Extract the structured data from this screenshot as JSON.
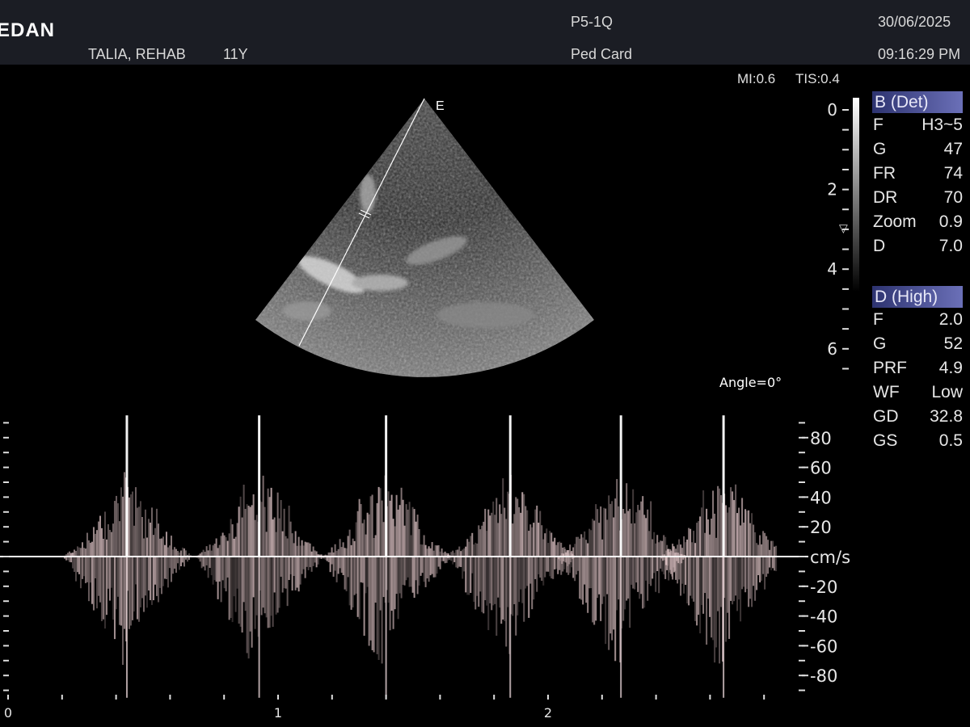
{
  "header": {
    "logo": "EDAN",
    "patient_name": "TALIA, REHAB",
    "patient_age": "11Y",
    "probe": "P5-1Q",
    "preset": "Ped Card",
    "date": "30/06/2025",
    "time": "09:16:29 PM"
  },
  "indices": {
    "mi": "MI:0.6",
    "tis": "TIS:0.4"
  },
  "bmode_panel": {
    "title": "B (Det)",
    "params": [
      {
        "key": "F",
        "value": "H3~5"
      },
      {
        "key": "G",
        "value": "47"
      },
      {
        "key": "FR",
        "value": "74"
      },
      {
        "key": "DR",
        "value": "70"
      },
      {
        "key": "Zoom",
        "value": "0.9"
      },
      {
        "key": "D",
        "value": "7.0"
      }
    ]
  },
  "doppler_panel": {
    "title": "D (High)",
    "params": [
      {
        "key": "F",
        "value": "2.0"
      },
      {
        "key": "G",
        "value": "52"
      },
      {
        "key": "PRF",
        "value": "4.9"
      },
      {
        "key": "WF",
        "value": "Low"
      },
      {
        "key": "GD",
        "value": "32.8"
      },
      {
        "key": "GS",
        "value": "0.5"
      }
    ]
  },
  "sector": {
    "orientation_marker": "E",
    "angle_label": "Angle=0°"
  },
  "depth_scale": {
    "labels": [
      "0",
      "2",
      "4",
      "6"
    ]
  },
  "velocity_scale": {
    "labels": [
      "80",
      "60",
      "40",
      "20",
      "cm/s",
      "-20",
      "-40",
      "-60",
      "-80"
    ]
  },
  "time_axis": {
    "labels": [
      "0",
      "1",
      "2"
    ]
  },
  "spectral_trace": {
    "beat_times_s": [
      0.44,
      0.93,
      1.4,
      1.86,
      2.27,
      2.65
    ],
    "max_velocity_cm_s": 95
  },
  "colors": {
    "header_bg": "#1b1d24",
    "panel_title_bg": "#4b509a",
    "spectral_tint": "#f3d6d8"
  }
}
